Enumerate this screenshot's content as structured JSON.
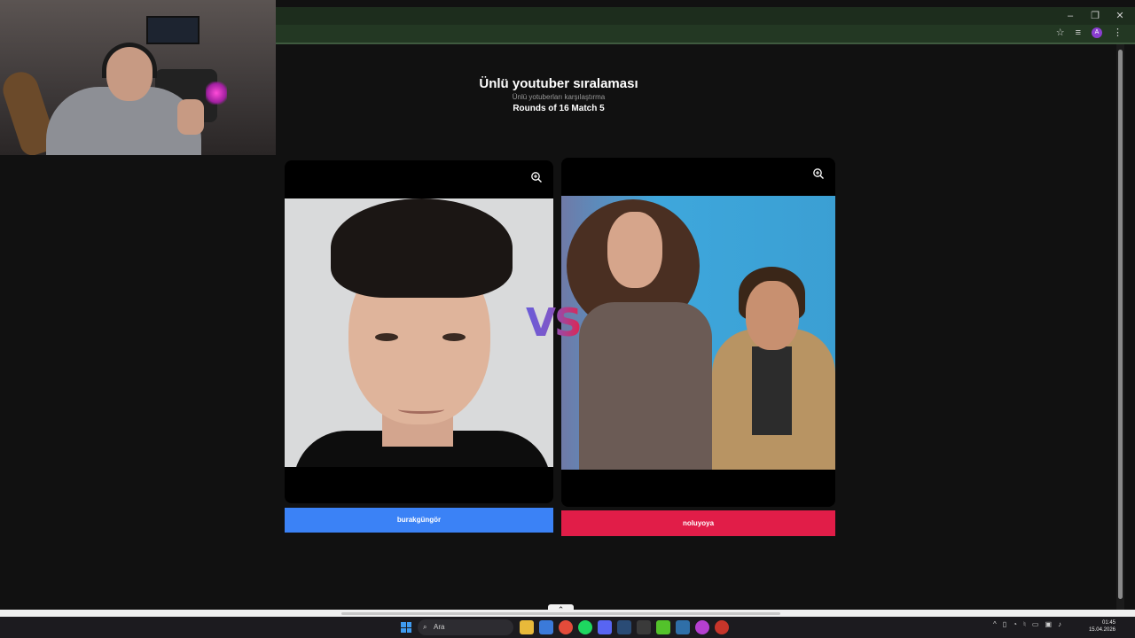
{
  "page": {
    "title": "Ünlü youtuber sıralaması",
    "subtitle": "Ünlü yotuberları karşılaştırma",
    "round_info": "Rounds of 16 Match 5",
    "vs_label": "VS"
  },
  "contestants": [
    {
      "name": "burakgüngör",
      "button_color": "#3b82f6"
    },
    {
      "name": "noluyoya",
      "button_color": "#e11d48"
    }
  ],
  "browser": {
    "minimize": "–",
    "restore": "❐",
    "close": "✕",
    "profile_initial": "A"
  },
  "taskbar": {
    "search_placeholder": "Ara",
    "time": "01:45",
    "date": "15.04.2026"
  },
  "icons": [
    "zoom-in-icon",
    "chevron-up-icon",
    "windows-start-icon",
    "search-icon",
    "star-icon",
    "extensions-icon",
    "menu-icon"
  ]
}
